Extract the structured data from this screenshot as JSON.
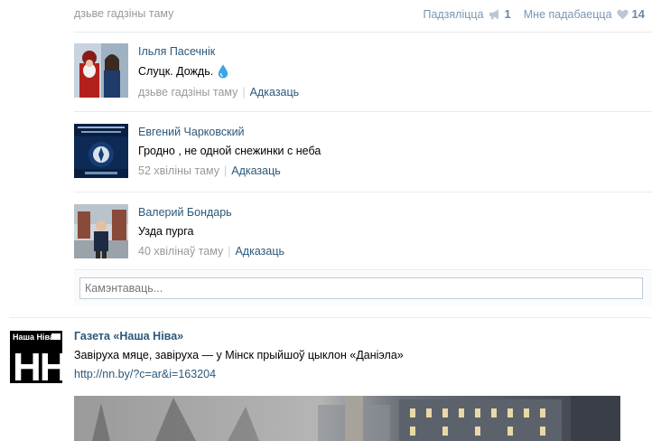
{
  "top": {
    "time": "дзьве гадзіны таму",
    "share_label": "Падзяліцца",
    "share_count": "1",
    "like_label": "Мне падабаецца",
    "like_count": "14"
  },
  "comments": [
    {
      "author": "Ільля Пасечнік",
      "text": "Слуцк. Дождь.",
      "time": "дзьве гадзіны таму",
      "reply": "Адказаць"
    },
    {
      "author": "Евгений Чарковский",
      "text": "Гродно , не одной снежинки с неба",
      "time": "52 хвіліны таму",
      "reply": "Адказаць"
    },
    {
      "author": "Валерий Бондарь",
      "text": "Узда пурга",
      "time": "40 хвілінаў таму",
      "reply": "Адказаць"
    }
  ],
  "comment_input": {
    "placeholder": "Камэнтаваць..."
  },
  "post": {
    "logo_text": "Наша Ніва",
    "logo_letters": "НН",
    "author": "Газета «Наша Ніва»",
    "text": "Завіруха мяце, завіруха — у Мінск прыйшоў цыклон «Даніэла»",
    "link": "http://nn.by/?c=ar&i=163204"
  },
  "colors": {
    "link": "#2b587a",
    "muted": "#999999",
    "divider": "#e7ebf0",
    "icon": "#b9c8d8"
  }
}
